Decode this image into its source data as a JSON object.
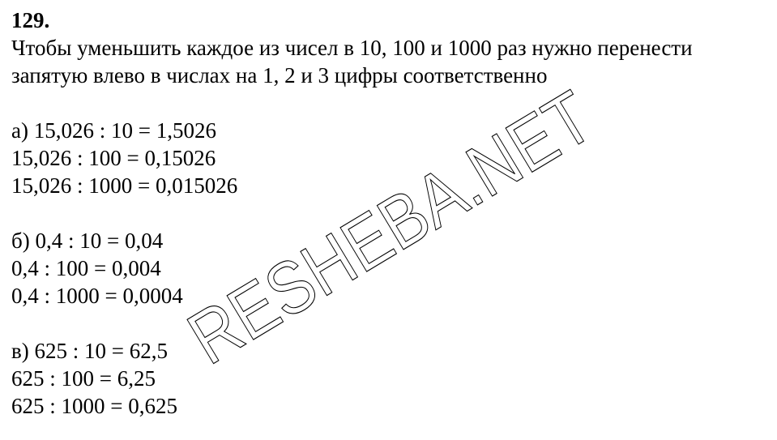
{
  "task": {
    "number": "129."
  },
  "intro": {
    "line1": "Чтобы уменьшить каждое из чисел в 10, 100 и 1000 раз нужно перенести",
    "line2": "запятую влево в числах на 1, 2 и 3 цифры соответственно"
  },
  "parts": [
    {
      "lines": [
        "а) 15,026 : 10 = 1,5026",
        "15,026 : 100 = 0,15026",
        "15,026 : 1000 = 0,015026"
      ]
    },
    {
      "lines": [
        "б) 0,4 : 10 = 0,04",
        "0,4 : 100 = 0,004",
        "0,4 : 1000 = 0,0004"
      ]
    },
    {
      "lines": [
        "в) 625 : 10 = 62,5",
        "625 : 100 = 6,25",
        "625 : 1000 = 0,625"
      ]
    }
  ],
  "watermark": {
    "text": "RESHEBA.NET",
    "color": "#000000"
  }
}
